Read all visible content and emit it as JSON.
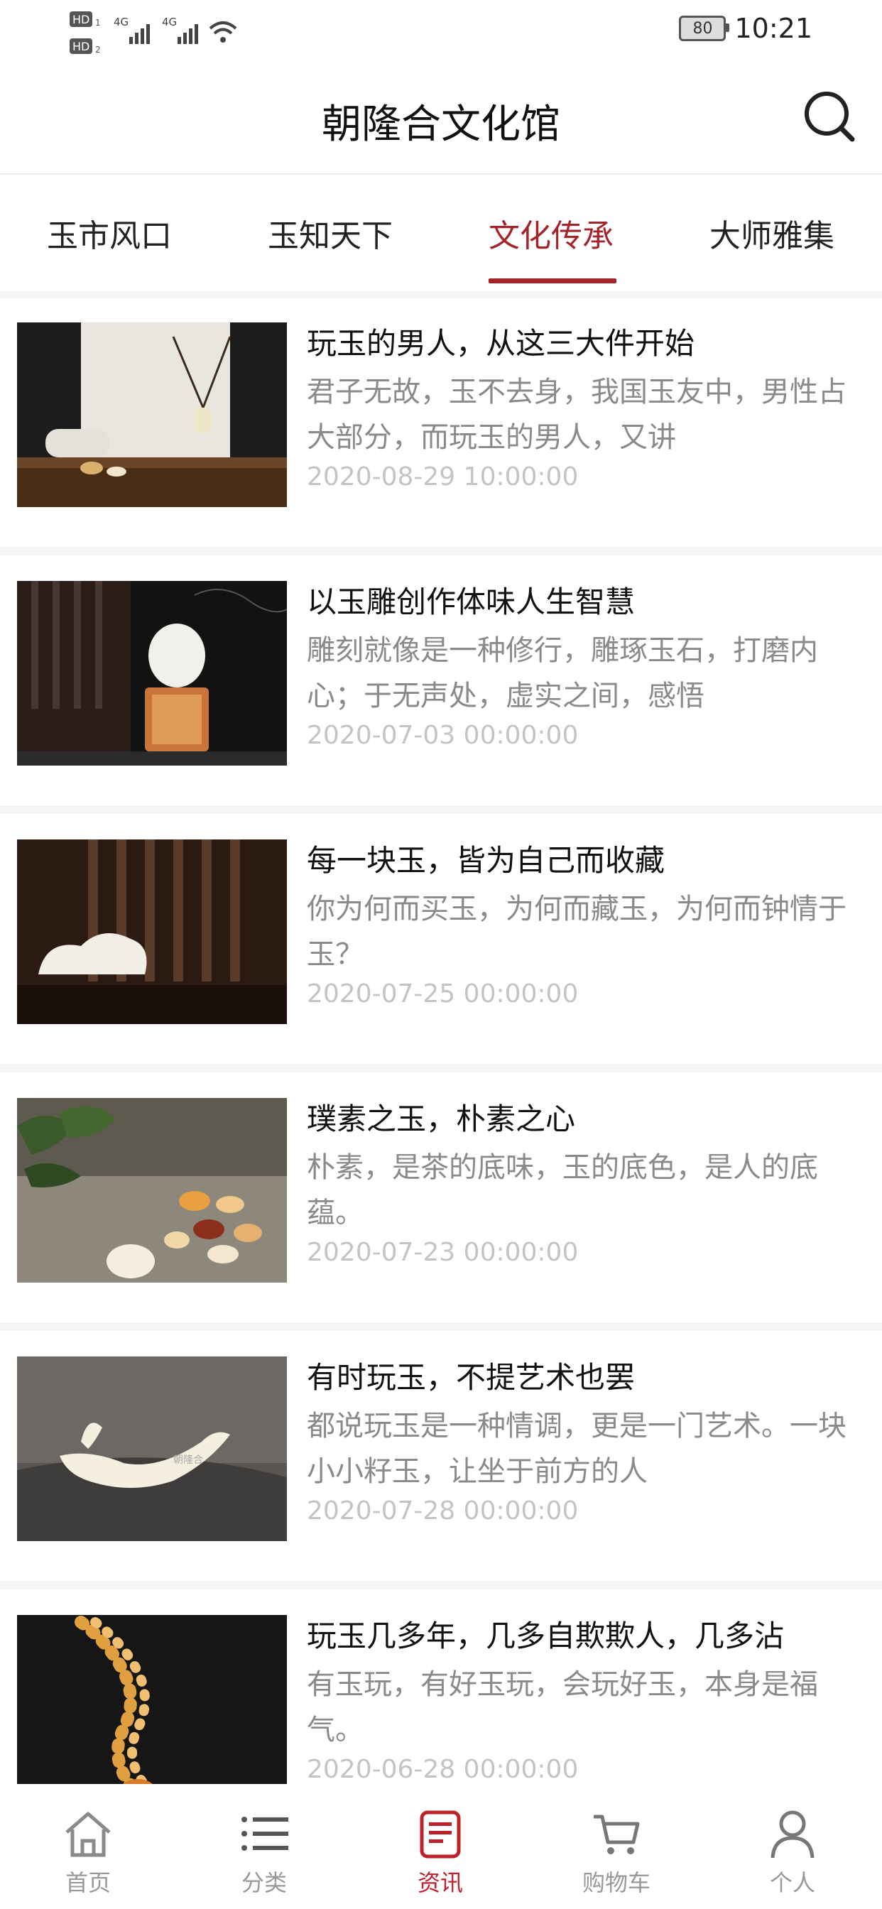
{
  "status_bar": {
    "hd1": "HD",
    "hd1_sub": "1",
    "hd2": "HD",
    "hd2_sub": "2",
    "net1": "4G",
    "net2": "4G",
    "battery": "80",
    "time": "10:21"
  },
  "header": {
    "title": "朝隆合文化馆",
    "search_icon": "search-icon"
  },
  "tabs": [
    {
      "label": "玉市风口",
      "active": false
    },
    {
      "label": "玉知天下",
      "active": false
    },
    {
      "label": "文化传承",
      "active": true
    },
    {
      "label": "大师雅集",
      "active": false
    }
  ],
  "articles": [
    {
      "title": "玩玉的男人，从这三大件开始",
      "summary": "君子无故，玉不去身，我国玉友中，男性占大部分，而玩玉的男人，又讲",
      "date": "2020-08-29 10:00:00"
    },
    {
      "title": "以玉雕创作体味人生智慧",
      "summary": "雕刻就像是一种修行，雕琢玉石，打磨内心；于无声处，虚实之间，感悟",
      "date": "2020-07-03 00:00:00"
    },
    {
      "title": "每一块玉，皆为自己而收藏",
      "summary": "你为何而买玉，为何而藏玉，为何而钟情于玉？",
      "date": "2020-07-25 00:00:00"
    },
    {
      "title": "璞素之玉，朴素之心",
      "summary": "朴素，是茶的底味，玉的底色，是人的底蕴。",
      "date": "2020-07-23 00:00:00"
    },
    {
      "title": "有时玩玉，不提艺术也罢",
      "summary": "都说玩玉是一种情调，更是一门艺术。一块小小籽玉，让坐于前方的人",
      "date": "2020-07-28 00:00:00"
    },
    {
      "title": "玩玉几多年，几多自欺欺人，几多沾",
      "summary": "有玉玩，有好玉玩，会玩好玉，本身是福气。",
      "date": "2020-06-28 00:00:00"
    }
  ],
  "watermark": "朝隆合",
  "bottom_nav": [
    {
      "label": "首页",
      "icon": "home-icon",
      "active": false
    },
    {
      "label": "分类",
      "icon": "list-icon",
      "active": false
    },
    {
      "label": "资讯",
      "icon": "news-icon",
      "active": true
    },
    {
      "label": "购物车",
      "icon": "cart-icon",
      "active": false
    },
    {
      "label": "个人",
      "icon": "user-icon",
      "active": false
    }
  ],
  "colors": {
    "accent": "#a3242a",
    "nav_active": "#c0202a",
    "summary_text": "#8a8a8a",
    "date_text": "#c4c4c4"
  }
}
